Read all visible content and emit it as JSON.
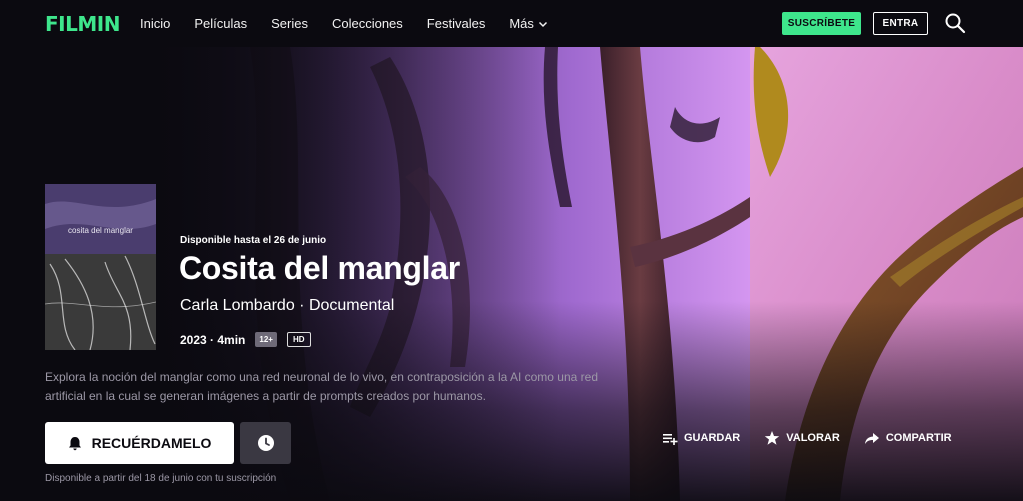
{
  "brand": {
    "logo": "FILMIN",
    "accent": "#3ee68c"
  },
  "nav": {
    "items": [
      "Inicio",
      "Películas",
      "Series",
      "Colecciones",
      "Festivales"
    ],
    "more": "Más",
    "subscribe": "SUSCRÍBETE",
    "login": "ENTRA",
    "search_icon": "search-icon"
  },
  "hero": {
    "poster_title": "cosita del manglar",
    "availability": "Disponible hasta el 26 de junio",
    "title": "Cosita del manglar",
    "credits": "Carla Lombardo · Documental",
    "year_duration": "2023 · 4min",
    "age_rating": "12+",
    "quality": "HD",
    "description": "Explora la noción del manglar como una red neuronal de lo vivo, en contraposición a la AI como una red artificial en la cual se generan imágenes a partir de prompts creados por humanos.",
    "remind_button": "RECUÉRDAMELO",
    "subscription_note": "Disponible a partir del 18 de junio con tu suscripción",
    "actions": {
      "save": "GUARDAR",
      "rate": "VALORAR",
      "share": "COMPARTIR"
    }
  }
}
